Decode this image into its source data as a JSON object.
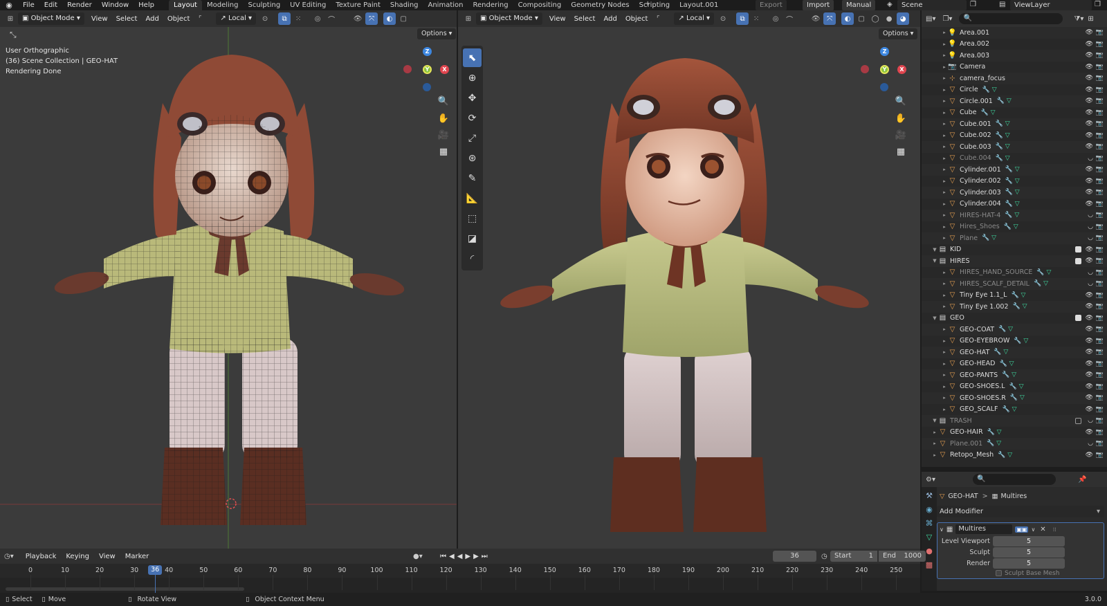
{
  "topbar": {
    "menu": [
      "File",
      "Edit",
      "Render",
      "Window",
      "Help"
    ],
    "workspaces": [
      "Layout",
      "Modeling",
      "Sculpting",
      "UV Editing",
      "Texture Paint",
      "Shading",
      "Animation",
      "Rendering",
      "Compositing",
      "Geometry Nodes",
      "Scripting",
      "Layout.001"
    ],
    "active_workspace": "Layout",
    "add_tab": "+",
    "export_label": "Export",
    "import_label": "Import",
    "manual_label": "Manual",
    "scene_label": "Scene",
    "viewlayer_label": "ViewLayer"
  },
  "left_viewport": {
    "mode": "Object Mode",
    "menus": [
      "View",
      "Select",
      "Add",
      "Object"
    ],
    "transform_orientation": "Local",
    "options_label": "Options",
    "info_lines": [
      "User Orthographic",
      "(36) Scene Collection | GEO-HAT",
      "Rendering Done"
    ]
  },
  "right_viewport": {
    "mode": "Object Mode",
    "menus": [
      "View",
      "Select",
      "Add",
      "Object"
    ],
    "transform_orientation": "Local",
    "options_label": "Options"
  },
  "gizmo": {
    "x": "X",
    "y": "Y",
    "z": "Z",
    "x_color": "#e0454f",
    "y_color": "#8ac43c",
    "z_color": "#3d87e0"
  },
  "outliner": {
    "rows": [
      {
        "label": "Area.001",
        "icon": "light",
        "depth": 1,
        "dim": false
      },
      {
        "label": "Area.002",
        "icon": "light",
        "depth": 1,
        "dim": false
      },
      {
        "label": "Area.003",
        "icon": "light",
        "depth": 1,
        "dim": false
      },
      {
        "label": "Camera",
        "icon": "camera",
        "depth": 1,
        "dim": false
      },
      {
        "label": "camera_focus",
        "icon": "empty",
        "depth": 1,
        "dim": false
      },
      {
        "label": "Circle",
        "icon": "mesh",
        "depth": 1,
        "dim": false
      },
      {
        "label": "Circle.001",
        "icon": "mesh",
        "depth": 1,
        "dim": false
      },
      {
        "label": "Cube",
        "icon": "mesh",
        "depth": 1,
        "dim": false
      },
      {
        "label": "Cube.001",
        "icon": "mesh",
        "depth": 1,
        "dim": false
      },
      {
        "label": "Cube.002",
        "icon": "mesh",
        "depth": 1,
        "dim": false
      },
      {
        "label": "Cube.003",
        "icon": "mesh",
        "depth": 1,
        "dim": false
      },
      {
        "label": "Cube.004",
        "icon": "mesh",
        "depth": 1,
        "dim": true
      },
      {
        "label": "Cylinder.001",
        "icon": "mesh",
        "depth": 1,
        "dim": false
      },
      {
        "label": "Cylinder.002",
        "icon": "mesh",
        "depth": 1,
        "dim": false
      },
      {
        "label": "Cylinder.003",
        "icon": "mesh",
        "depth": 1,
        "dim": false
      },
      {
        "label": "Cylinder.004",
        "icon": "mesh",
        "depth": 1,
        "dim": false
      },
      {
        "label": "HIRES-HAT-4",
        "icon": "mesh",
        "depth": 1,
        "dim": true
      },
      {
        "label": "Hires_Shoes",
        "icon": "mesh",
        "depth": 1,
        "dim": true
      },
      {
        "label": "Plane",
        "icon": "mesh",
        "depth": 1,
        "dim": true
      },
      {
        "label": "KID",
        "icon": "collection",
        "depth": 0,
        "dim": false
      },
      {
        "label": "HIRES",
        "icon": "collection",
        "depth": 0,
        "dim": false
      },
      {
        "label": "HIRES_HAND_SOURCE",
        "icon": "mesh",
        "depth": 1,
        "dim": true
      },
      {
        "label": "HIRES_SCALF_DETAIL",
        "icon": "mesh",
        "depth": 1,
        "dim": true
      },
      {
        "label": "Tiny Eye 1.1_L",
        "icon": "mesh",
        "depth": 1,
        "dim": false
      },
      {
        "label": "Tiny Eye 1.002",
        "icon": "mesh",
        "depth": 1,
        "dim": false
      },
      {
        "label": "GEO",
        "icon": "collection",
        "depth": 0,
        "dim": false
      },
      {
        "label": "GEO-COAT",
        "icon": "mesh",
        "depth": 1,
        "dim": false
      },
      {
        "label": "GEO-EYEBROW",
        "icon": "mesh",
        "depth": 1,
        "dim": false
      },
      {
        "label": "GEO-HAT",
        "icon": "mesh",
        "depth": 1,
        "dim": false
      },
      {
        "label": "GEO-HEAD",
        "icon": "mesh",
        "depth": 1,
        "dim": false
      },
      {
        "label": "GEO-PANTS",
        "icon": "mesh",
        "depth": 1,
        "dim": false
      },
      {
        "label": "GEO-SHOES.L",
        "icon": "mesh",
        "depth": 1,
        "dim": false
      },
      {
        "label": "GEO-SHOES.R",
        "icon": "mesh",
        "depth": 1,
        "dim": false
      },
      {
        "label": "GEO_SCALF",
        "icon": "mesh",
        "depth": 1,
        "dim": false
      },
      {
        "label": "TRASH",
        "icon": "collection",
        "depth": 0,
        "dim": true
      },
      {
        "label": "GEO-HAIR",
        "icon": "mesh",
        "depth": 0,
        "dim": false
      },
      {
        "label": "Plane.001",
        "icon": "mesh",
        "depth": 0,
        "dim": true
      },
      {
        "label": "Retopo_Mesh",
        "icon": "mesh",
        "depth": 0,
        "dim": false
      }
    ]
  },
  "properties": {
    "breadcrumb_object": "GEO-HAT",
    "breadcrumb_sep": ">",
    "breadcrumb_modifier": "Multires",
    "add_modifier_label": "Add Modifier",
    "modifier_name": "Multires",
    "fields": [
      {
        "label": "Level Viewport",
        "value": "5"
      },
      {
        "label": "Sculpt",
        "value": "5"
      },
      {
        "label": "Render",
        "value": "5"
      }
    ],
    "sculpt_base_mesh_label": "Sculpt Base Mesh"
  },
  "timeline": {
    "menus": [
      "Playback",
      "Keying",
      "View",
      "Marker"
    ],
    "current_frame": "36",
    "start_label": "Start",
    "start_value": "1",
    "end_label": "End",
    "end_value": "1000",
    "ticks": [
      "0",
      "10",
      "20",
      "30",
      "40",
      "50",
      "60",
      "70",
      "80",
      "90",
      "100",
      "110",
      "120",
      "130",
      "140",
      "150",
      "160",
      "170",
      "180",
      "190",
      "200",
      "210",
      "220",
      "230",
      "240",
      "250"
    ]
  },
  "statusbar": {
    "select_label": "Select",
    "move_label": "Move",
    "rotate_label": "Rotate View",
    "context_label": "Object Context Menu",
    "version": "3.0.0"
  }
}
